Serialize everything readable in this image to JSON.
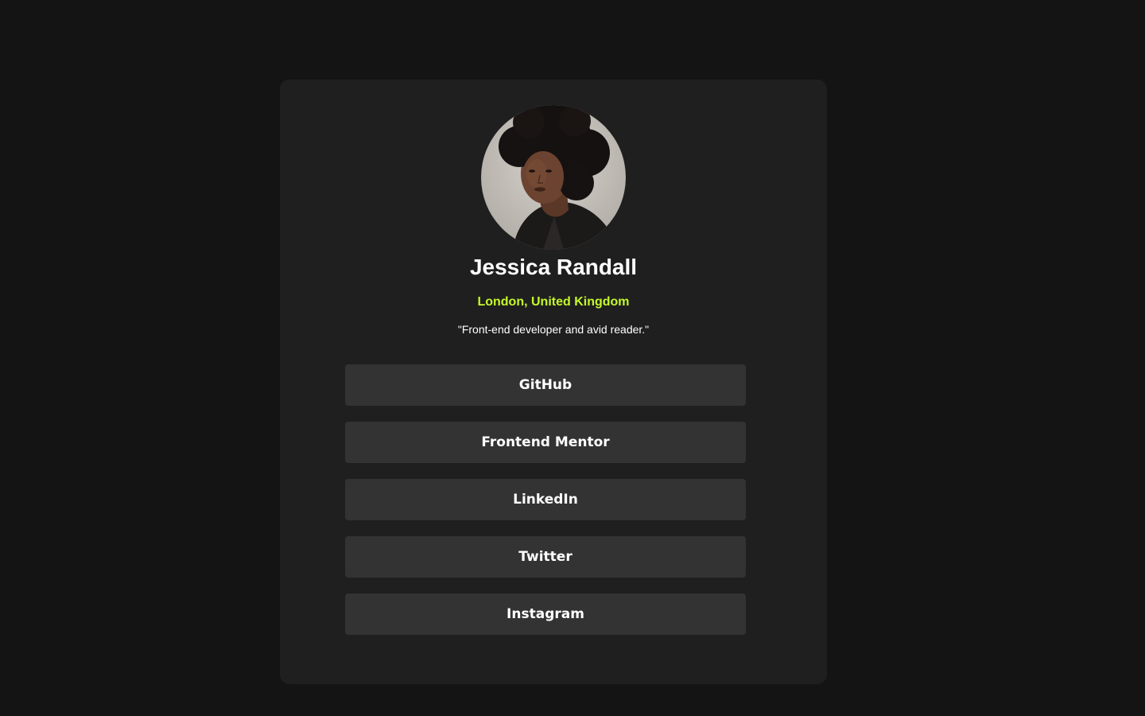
{
  "profile": {
    "name": "Jessica Randall",
    "location": "London, United Kingdom",
    "bio": "\"Front-end developer and avid reader.\""
  },
  "links": [
    {
      "label": "GitHub"
    },
    {
      "label": "Frontend Mentor"
    },
    {
      "label": "LinkedIn"
    },
    {
      "label": "Twitter"
    },
    {
      "label": "Instagram"
    }
  ],
  "colors": {
    "page_background": "#141414",
    "card_background": "#1f1f1f",
    "button_background": "#333333",
    "accent": "#c4f82a",
    "text": "#ffffff"
  }
}
